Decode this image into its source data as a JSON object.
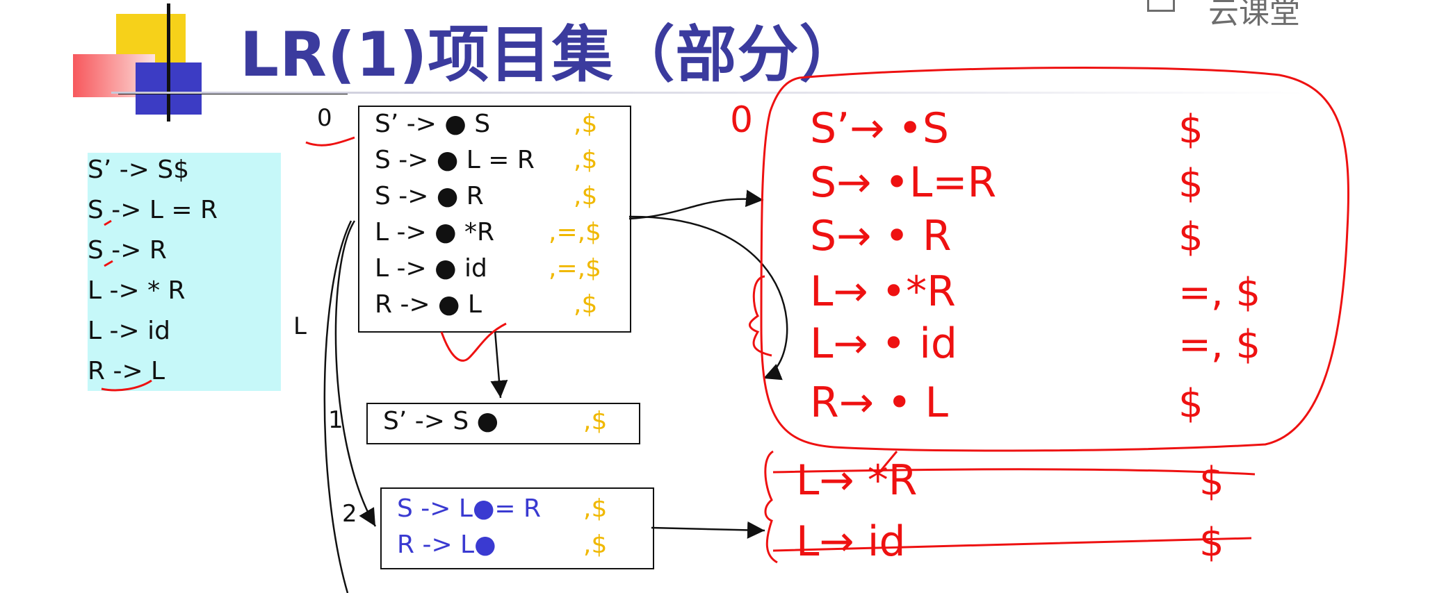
{
  "title": "LR(1)项目集（部分）",
  "watermark": "云课堂",
  "grammar": [
    "S’ -> S$",
    "S -> L = R",
    "S -> R",
    "L -> * R",
    "L -> id",
    "R -> L"
  ],
  "edge_label_L": "L",
  "states": {
    "s0": {
      "number": "0",
      "items": [
        {
          "prod": "S’ -> ● S",
          "la": ",$"
        },
        {
          "prod": "S -> ● L = R",
          "la": ",$"
        },
        {
          "prod": "S -> ● R",
          "la": ",$"
        },
        {
          "prod": "L -> ● *R",
          "la": ",=,$"
        },
        {
          "prod": "L -> ● id",
          "la": ",=,$"
        },
        {
          "prod": "R -> ● L",
          "la": ",$"
        }
      ]
    },
    "s1": {
      "number": "1",
      "items": [
        {
          "prod": "S’ -> S ●",
          "la": ",$"
        }
      ]
    },
    "s2": {
      "number": "2",
      "items": [
        {
          "prod": "S -> L●= R",
          "la": ",$"
        },
        {
          "prod": "R -> L●",
          "la": ",$"
        }
      ]
    }
  },
  "handwritten": {
    "state_number": "0",
    "closure_rows": [
      {
        "prod": "S’→ •S",
        "la": "$"
      },
      {
        "prod": "S→ •L=R",
        "la": "$"
      },
      {
        "prod": "S→ • R",
        "la": "$"
      },
      {
        "prod": "L→ •*R",
        "la": "=, $"
      },
      {
        "prod": "L→ • id",
        "la": "=, $"
      },
      {
        "prod": "R→ • L",
        "la": "$"
      }
    ],
    "struck_rows": [
      {
        "prod": "L→ *R",
        "la": "$"
      },
      {
        "prod": "L→ id",
        "la": "$"
      }
    ]
  },
  "colors": {
    "title": "#3b3b9e",
    "lookahead": "#f0b800",
    "item_blue": "#3a3ad1",
    "annotation_red": "#ee1111",
    "grammar_bg": "#c6f8f9"
  }
}
